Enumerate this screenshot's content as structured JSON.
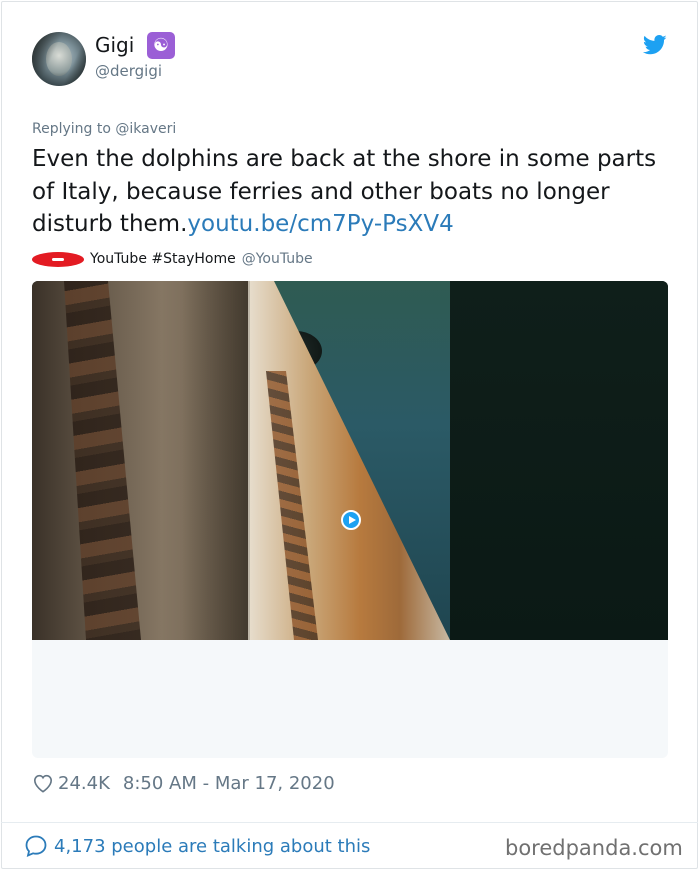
{
  "author": {
    "name": "Gigi",
    "name_emoji": "☯",
    "handle": "@dergigi"
  },
  "icons": {
    "avatar": "profile-photo",
    "twitter_logo": "twitter-bird-icon",
    "emoji": "yin-yang-icon",
    "play": "play-icon",
    "like": "heart-icon",
    "reply": "speech-bubble-icon",
    "source_logo": "youtube-logo"
  },
  "tweet": {
    "replying_to": "Replying to @ikaveri",
    "text": "Even the dolphins are back at the shore in some parts of Italy, because ferries and other boats no longer disturb them.",
    "link": "youtu.be/cm7Py-PsXV4"
  },
  "card_source": {
    "name": "YouTube #StayHome",
    "handle": "@YouTube"
  },
  "footer": {
    "likes": "24.4K",
    "timestamp": "8:50 AM - Mar 17, 2020",
    "talking": "4,173 people are talking about this"
  },
  "watermark": "boredpanda.com",
  "colors": {
    "link": "#2b7bb9",
    "twitter_blue": "#1da1f2",
    "muted": "#657786",
    "youtube_red": "#e31b23"
  }
}
